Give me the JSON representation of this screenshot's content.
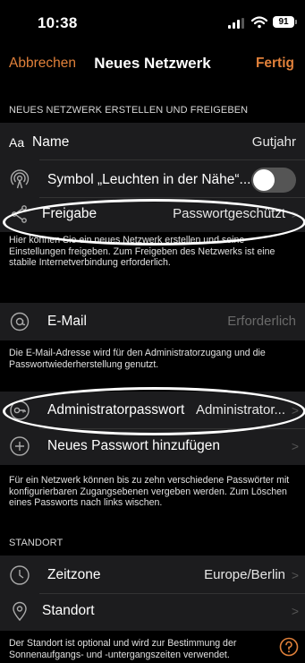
{
  "status": {
    "time": "10:38",
    "battery": "91"
  },
  "nav": {
    "cancel": "Abbrechen",
    "title": "Neues Netzwerk",
    "done": "Fertig"
  },
  "section1": {
    "header": "NEUES NETZWERK ERSTELLEN UND FREIGEBEN",
    "name_label": "Name",
    "name_prefix": "Aa",
    "name_value": "Gutjahr",
    "beacon_label": "Symbol „Leuchten in der Nähe“...",
    "beacon_on": false,
    "share_label": "Freigabe",
    "share_value": "Passwortgeschützt",
    "footnote": "Hier können Sie ein neues Netzwerk erstellen und seine Einstellungen freigeben. Zum Freigeben des Netzwerks ist eine stabile Internetverbindung erforderlich."
  },
  "section2": {
    "email_label": "E-Mail",
    "email_placeholder": "Erforderlich",
    "footnote": "Die E-Mail-Adresse wird für den Administratorzugang und die Passwortwiederherstellung genutzt."
  },
  "section3": {
    "admin_label": "Administratorpasswort",
    "admin_value": "Administrator...",
    "add_label": "Neues Passwort hinzufügen",
    "footnote": "Für ein Netzwerk können bis zu zehn verschiedene Passwörter mit konfigurierbaren Zugangsebenen vergeben werden. Zum Löschen eines Passworts nach links wischen."
  },
  "section4": {
    "header": "STANDORT",
    "timezone_label": "Zeitzone",
    "timezone_value": "Europe/Berlin",
    "location_label": "Standort",
    "footnote": "Der Standort ist optional und wird zur Bestimmung der Sonnenaufgangs- und -untergangszeiten verwendet."
  },
  "colors": {
    "accent": "#e0803a",
    "cell": "#1c1c1e",
    "background": "#000000"
  }
}
